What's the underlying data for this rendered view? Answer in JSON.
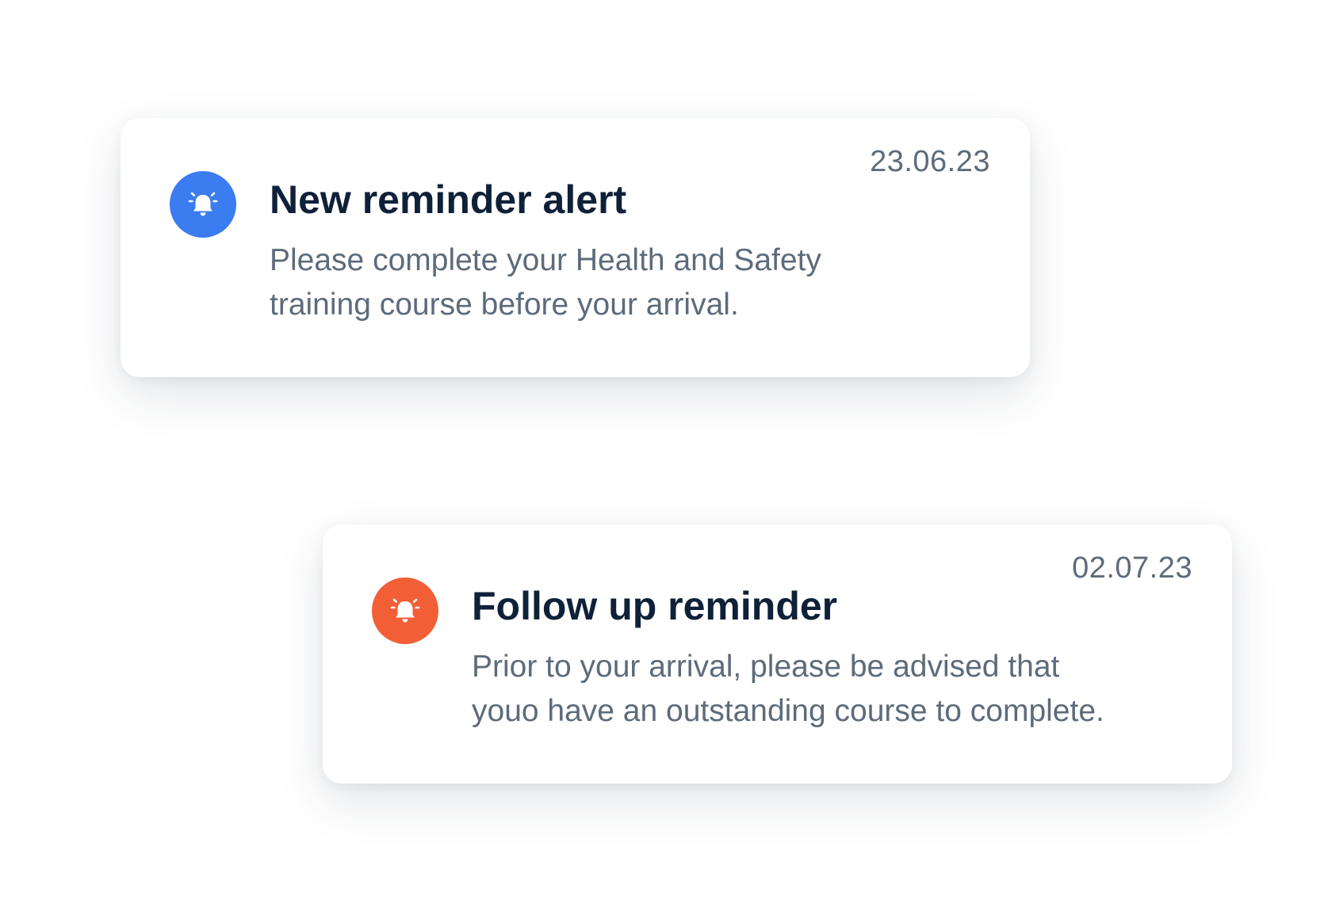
{
  "notifications": [
    {
      "date": "23.06.23",
      "title": "New reminder alert",
      "message_lines": [
        "Please complete your Health and Safety",
        "training course before your arrival."
      ],
      "icon": "bell-alert-icon",
      "accent_color": "#3b7cf0"
    },
    {
      "date": "02.07.23",
      "title": "Follow up reminder",
      "message_lines": [
        "Prior to your arrival, please be advised that",
        "youo have an outstanding course to complete."
      ],
      "icon": "bell-alert-icon",
      "accent_color": "#f25f36"
    }
  ]
}
